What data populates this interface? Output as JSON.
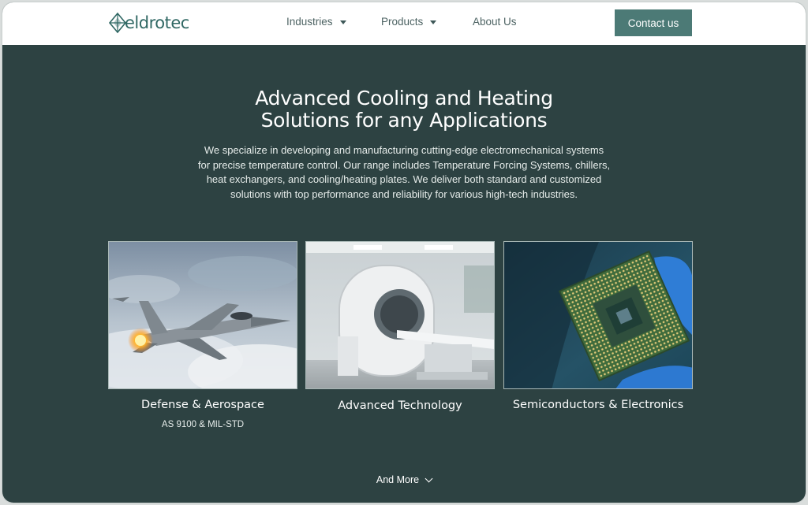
{
  "brand": {
    "logo_text": "eldrotec",
    "color": "#2f6763"
  },
  "nav": {
    "items": [
      {
        "label": "Industries",
        "has_dropdown": true,
        "icon": "caret-down-icon"
      },
      {
        "label": "Products",
        "has_dropdown": true,
        "icon": "caret-down-icon"
      },
      {
        "label": "About Us",
        "has_dropdown": false
      }
    ],
    "cta_label": "Contact us",
    "cta_color": "#4c7a76"
  },
  "hero": {
    "title_lines": [
      "Advanced Cooling and Heating",
      "Solutions for any Applications"
    ],
    "description_lines": [
      "We specialize in developing and manufacturing cutting-edge electromechanical systems",
      "for precise temperature control. Our range includes Temperature Forcing Systems, chillers,",
      "heat exchangers, and cooling/heating plates. We deliver both standard and customized",
      "solutions with top performance and reliability for various high-tech industries."
    ],
    "background_color": "#2d4242"
  },
  "industries": [
    {
      "title": "Defense & Aerospace",
      "subtitle": "AS 9100 & MIL-STD",
      "image": "fighter-jet-photo"
    },
    {
      "title": "Advanced Technology",
      "subtitle": "",
      "image": "ct-scanner-photo"
    },
    {
      "title": "Semiconductors & Electronics",
      "subtitle": "",
      "image": "cpu-chip-photo"
    }
  ],
  "more": {
    "label": "And More",
    "icon": "chevron-down-icon"
  }
}
